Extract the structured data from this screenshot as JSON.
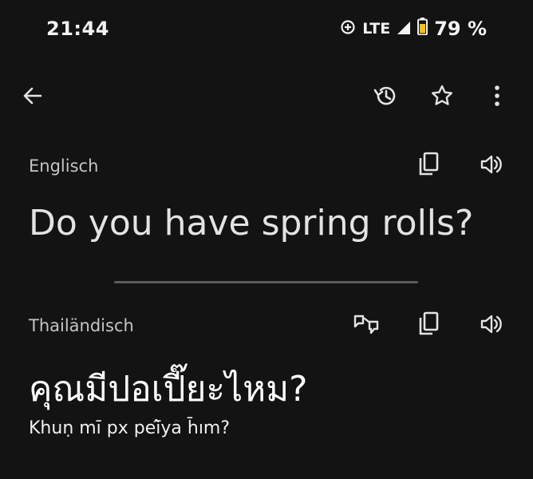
{
  "status_bar": {
    "time": "21:44",
    "network": "LTE",
    "battery": "79 %",
    "icons": [
      "data-saver-icon",
      "signal-icon",
      "battery-icon"
    ]
  },
  "toolbar": {
    "icons": [
      "back-arrow-icon",
      "history-icon",
      "star-icon",
      "more-vert-icon"
    ]
  },
  "source": {
    "language": "Englisch",
    "text": "Do you have spring rolls?",
    "icons": [
      "copy-icon",
      "speaker-icon"
    ]
  },
  "target": {
    "language": "Thailändisch",
    "text": "คุณมีปอเปี๊ยะไหม?",
    "transliteration": "Khuṇ mī px peī̂ya h̄ım?",
    "icons": [
      "swap-icon",
      "copy-icon",
      "speaker-icon"
    ]
  },
  "colors": {
    "background": "#131313",
    "text": "#e3e3e3",
    "secondary_text": "#c4c4c4",
    "divider": "#5c5c5c",
    "battery_fill": "#f4c21a"
  }
}
